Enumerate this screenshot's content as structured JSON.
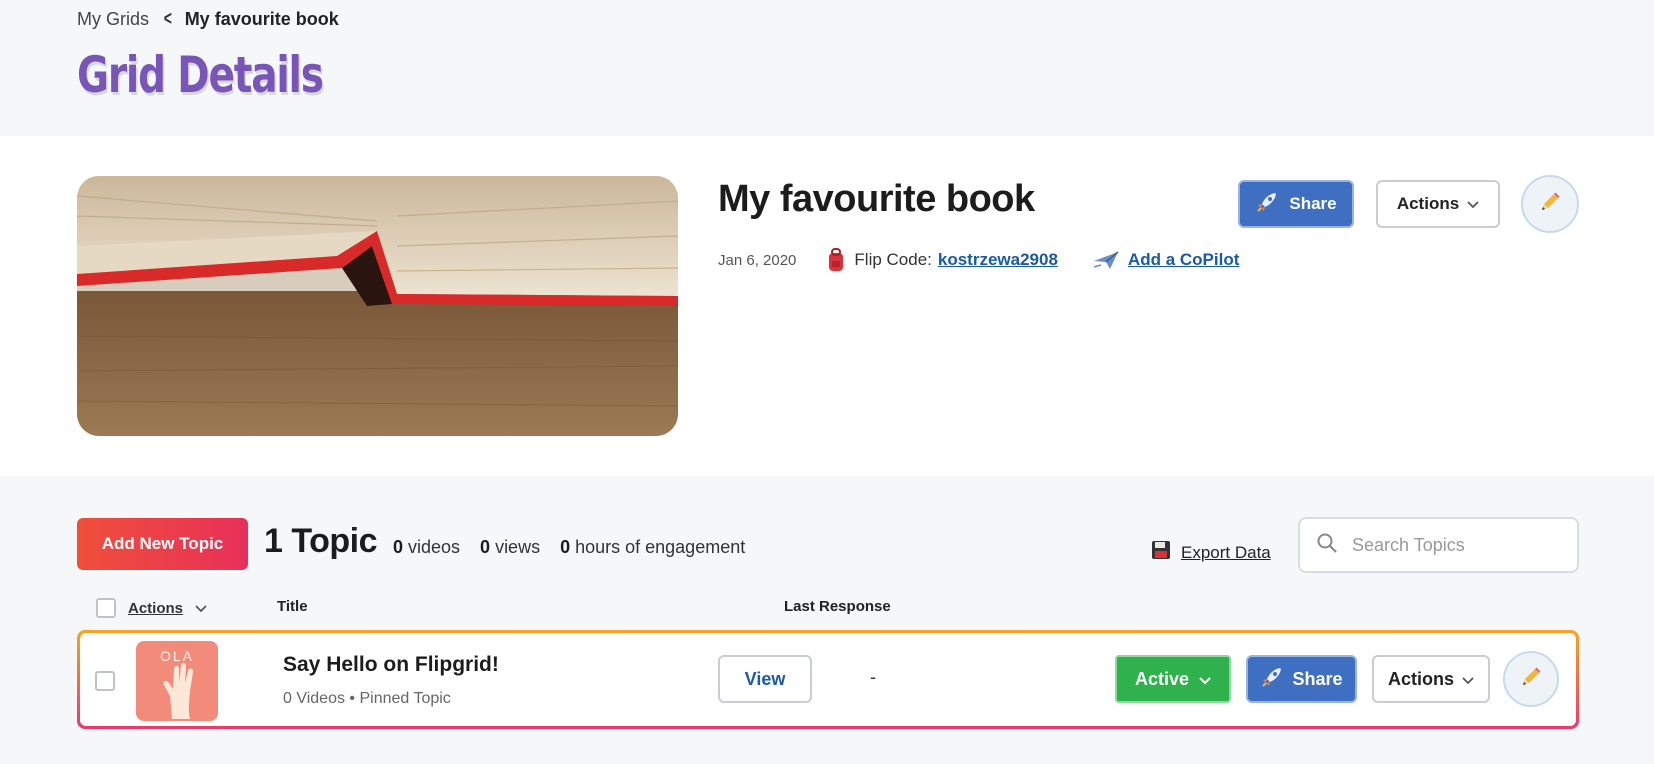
{
  "breadcrumb": {
    "parent": "My Grids",
    "current": "My favourite book"
  },
  "page_title": "Grid Details",
  "grid": {
    "name": "My favourite book",
    "date": "Jan 6, 2020",
    "flip_code_label": "Flip Code:",
    "flip_code": "kostrzewa2908",
    "copilot_link": "Add a CoPilot",
    "share_label": "Share",
    "actions_label": "Actions",
    "icons": {
      "share": "rocket-icon",
      "edit": "pencil-icon",
      "flip_code": "backpack-icon",
      "copilot": "airplane-icon"
    }
  },
  "topics": {
    "add_button": "Add New Topic",
    "count_label": "1 Topic",
    "stats": [
      {
        "value": "0",
        "label": "videos"
      },
      {
        "value": "0",
        "label": "views"
      },
      {
        "value": "0",
        "label": "hours of engagement"
      }
    ],
    "export_label": "Export Data",
    "search_placeholder": "Search Topics",
    "columns": {
      "actions": "Actions",
      "title": "Title",
      "last_response": "Last Response"
    },
    "rows": [
      {
        "thumb_text": "OLA",
        "title": "Say Hello on Flipgrid!",
        "subtitle": "0 Videos • Pinned Topic",
        "view_label": "View",
        "last_response": "-",
        "status_label": "Active",
        "share_label": "Share",
        "actions_label": "Actions"
      }
    ]
  },
  "colors": {
    "title_purple": "#7a55b8",
    "share_blue": "#3f6fc0",
    "active_green": "#2fb24c",
    "add_red": "#ef4f3a",
    "link_blue": "#1a5aa6"
  }
}
